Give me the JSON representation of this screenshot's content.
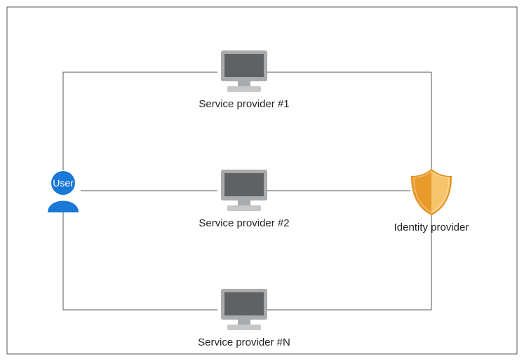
{
  "diagram": {
    "user_label": "User",
    "identity_provider_label": "Identity provider",
    "service_providers": [
      {
        "label": "Service provider #1"
      },
      {
        "label": "Service provider #2"
      },
      {
        "label": "Service provider #N"
      }
    ]
  },
  "colors": {
    "user": "#1a78d6",
    "shield_outer": "#e89a2b",
    "shield_inner": "#f6c46a",
    "monitor_body": "#a9abad",
    "monitor_screen": "#5f6163",
    "line": "#555555"
  }
}
